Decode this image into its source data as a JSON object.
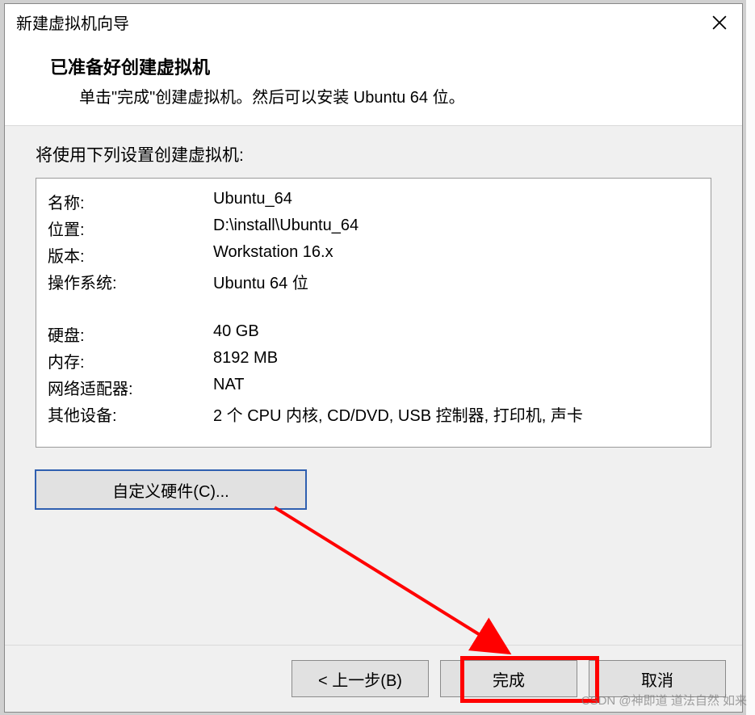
{
  "dialog": {
    "title": "新建虚拟机向导",
    "header_title": "已准备好创建虚拟机",
    "header_subtitle": "单击\"完成\"创建虚拟机。然后可以安装 Ubuntu 64 位。"
  },
  "body": {
    "intro": "将使用下列设置创建虚拟机:",
    "rows1": [
      {
        "k": "名称:",
        "v": "Ubuntu_64"
      },
      {
        "k": "位置:",
        "v": "D:\\install\\Ubuntu_64"
      },
      {
        "k": "版本:",
        "v": "Workstation 16.x"
      },
      {
        "k": "操作系统:",
        "v": "Ubuntu 64 位"
      }
    ],
    "rows2": [
      {
        "k": "硬盘:",
        "v": "40 GB"
      },
      {
        "k": "内存:",
        "v": "8192 MB"
      },
      {
        "k": "网络适配器:",
        "v": "NAT"
      },
      {
        "k": "其他设备:",
        "v": "2 个 CPU 内核, CD/DVD, USB 控制器, 打印机, 声卡"
      }
    ],
    "customize_hw": "自定义硬件(C)..."
  },
  "footer": {
    "back": "< 上一步(B)",
    "finish": "完成",
    "cancel": "取消"
  },
  "watermark": "CSDN @神即道 道法自然 如来",
  "annotation": {
    "arrow_color": "#ff0000",
    "highlight_color": "#ff0000"
  }
}
